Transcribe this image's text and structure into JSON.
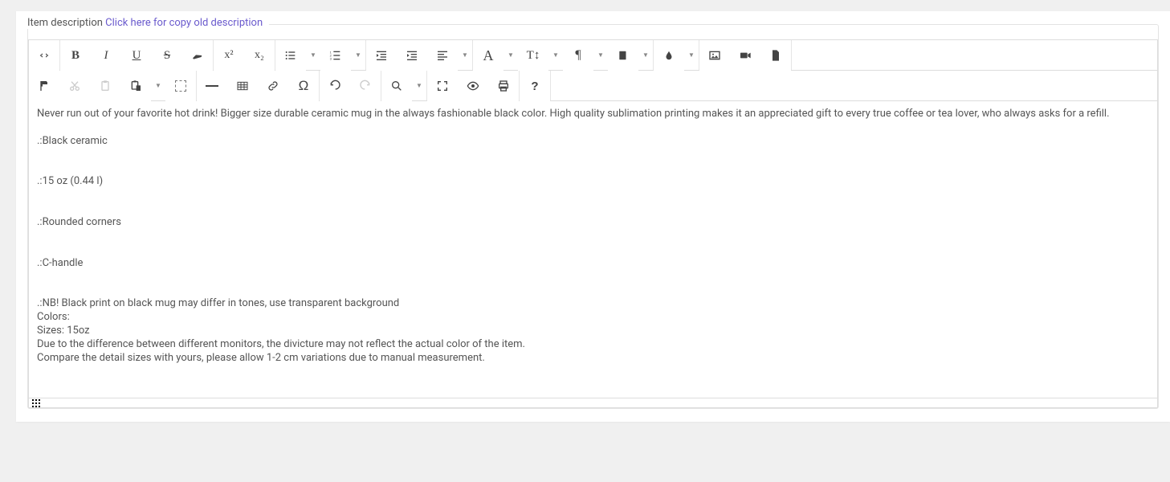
{
  "legend": {
    "label": "Item description",
    "linkText": "Click here for copy old description"
  },
  "content": {
    "p1": "Never run out of your favorite hot drink! Bigger size durable ceramic mug in the always fashionable black color. High quality sublimation printing makes it an appreciated gift to every true coffee or tea lover, who always asks for a refill.",
    "p2": ".:Black ceramic",
    "p3": ".:15 oz (0.44 l)",
    "p4": ".:Rounded corners",
    "p5": ".:C-handle",
    "p6": ".:NB! Black print on black mug may differ in tones, use transparent background",
    "p7": "Colors:",
    "p8": "Sizes: 15oz",
    "p9": "Due to the difference between different monitors, the divicture may not reflect the actual color of the item.",
    "p10": "Compare the detail sizes with yours, please allow 1-2 cm variations due to manual measurement."
  },
  "glyphs": {
    "bold": "B",
    "italic": "I",
    "underline": "U",
    "strike": "S",
    "sup": "x²",
    "sub": "x₂",
    "linespace": "T↕",
    "fontfamily": "A",
    "paragraph": "¶",
    "omega": "Ω",
    "help": "?"
  }
}
